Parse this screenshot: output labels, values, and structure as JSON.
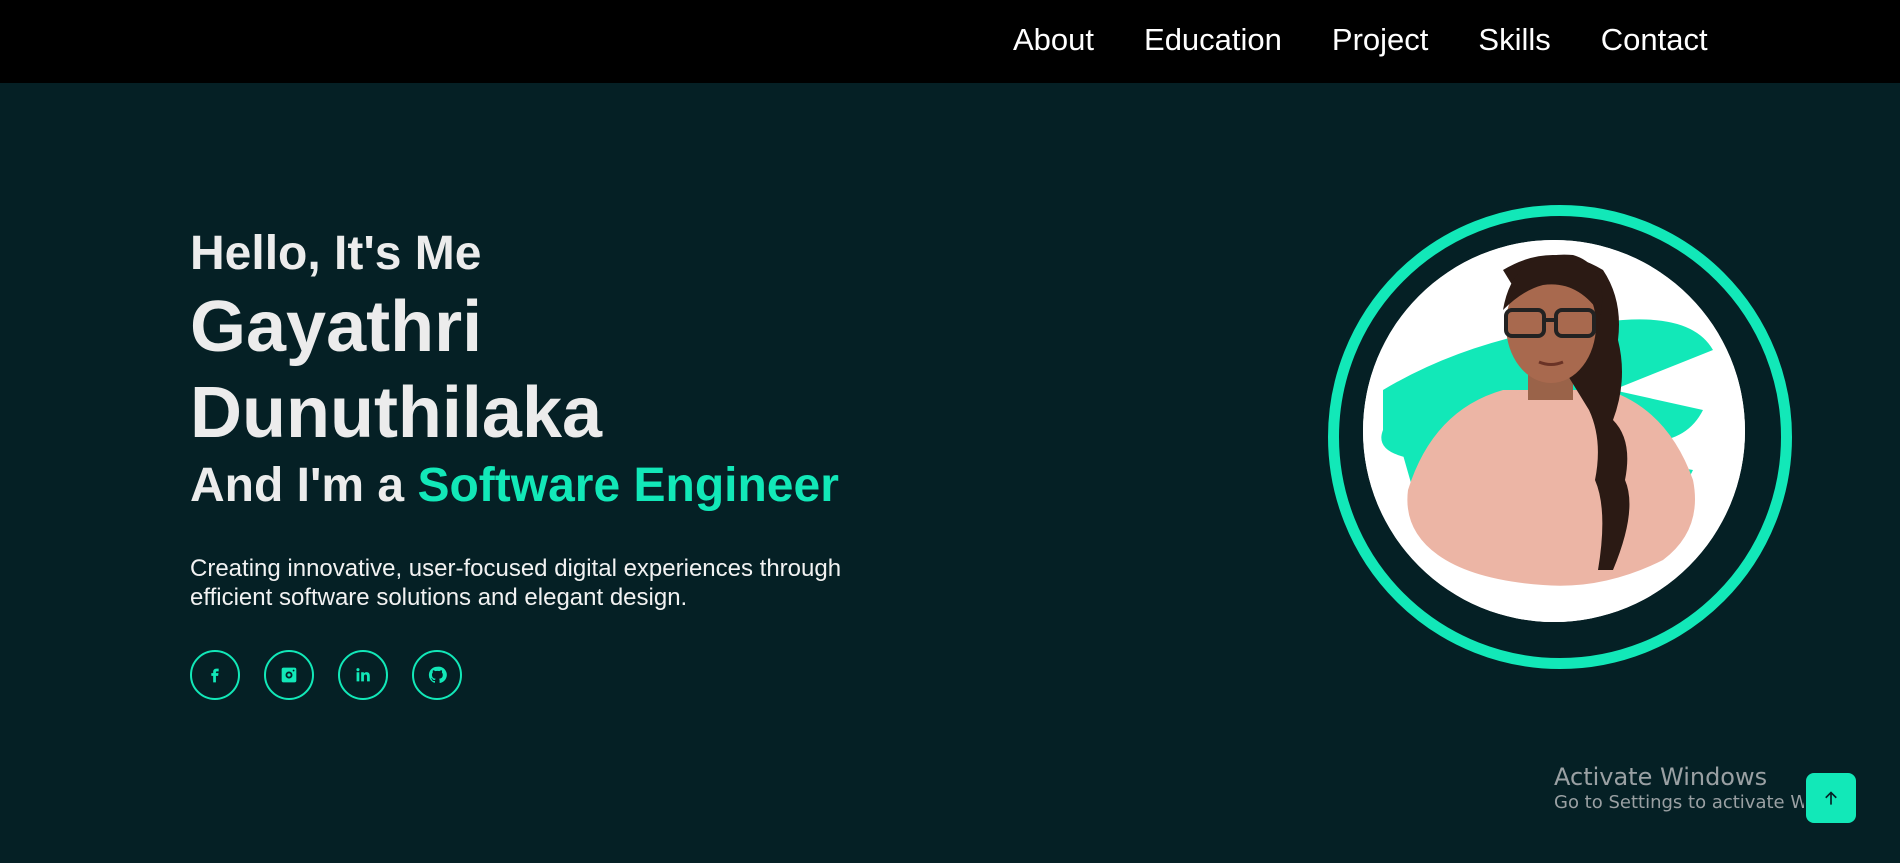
{
  "nav": {
    "items": [
      {
        "label": "About"
      },
      {
        "label": "Education"
      },
      {
        "label": "Project"
      },
      {
        "label": "Skills"
      },
      {
        "label": "Contact"
      }
    ]
  },
  "hero": {
    "greeting": "Hello, It's Me",
    "name_first": "Gayathri",
    "name_last": "Dunuthilaka",
    "role_prefix": "And I'm a ",
    "role": "Software Engineer",
    "description": "Creating innovative, user-focused digital experiences through efficient software solutions and elegant design."
  },
  "socials": [
    {
      "icon": "facebook-icon"
    },
    {
      "icon": "instagram-icon"
    },
    {
      "icon": "linkedin-icon"
    },
    {
      "icon": "github-icon"
    }
  ],
  "watermark": {
    "title": "Activate Windows",
    "subtitle": "Go to Settings to activate Windows."
  },
  "back_to_top": {
    "icon": "arrow-up-icon"
  },
  "colors": {
    "accent": "#12e8b8",
    "background": "#052025",
    "navbar": "#000000",
    "text": "#ececec"
  }
}
